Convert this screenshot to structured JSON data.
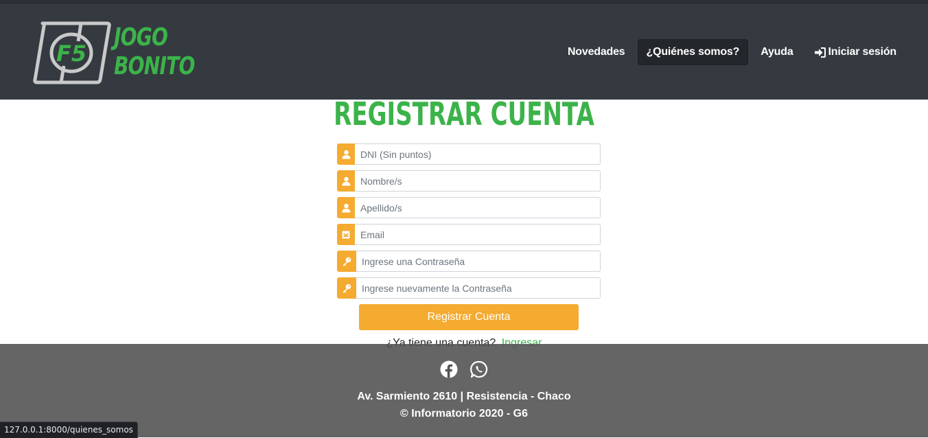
{
  "brand": {
    "logo_badge": "F5",
    "name_line1": "JOGO",
    "name_line2": "BONITO"
  },
  "nav": {
    "items": [
      {
        "label": "Novedades"
      },
      {
        "label": "¿Quiénes somos?"
      },
      {
        "label": "Ayuda"
      },
      {
        "label": "Iniciar sesión",
        "icon": "sign-in-icon"
      }
    ]
  },
  "page": {
    "title": "REGISTRAR CUENTA"
  },
  "form": {
    "fields": [
      {
        "placeholder": "DNI (Sin puntos)",
        "icon": "user-icon"
      },
      {
        "placeholder": "Nombre/s",
        "icon": "user-icon"
      },
      {
        "placeholder": "Apellido/s",
        "icon": "user-icon"
      },
      {
        "placeholder": "Email",
        "icon": "envelope-icon"
      },
      {
        "placeholder": "Ingrese una Contraseña",
        "icon": "key-icon"
      },
      {
        "placeholder": "Ingrese nuevamente la Contraseña",
        "icon": "key-icon"
      }
    ],
    "submit_label": "Registrar Cuenta",
    "login_prompt": "¿Ya tiene una cuenta?",
    "login_link": "Ingresar"
  },
  "footer": {
    "social": [
      "facebook-icon",
      "whatsapp-icon"
    ],
    "address": "Av. Sarmiento 2610 | Resistencia - Chaco",
    "copyright": "© Informatorio 2020 - G6"
  },
  "status_bar": {
    "url": "127.0.0.1:8000/quienes_somos"
  },
  "colors": {
    "brand_green": "#3cb34a",
    "accent_orange": "#f4ab30",
    "header_bg": "#343a40",
    "footer_bg": "#555555"
  }
}
